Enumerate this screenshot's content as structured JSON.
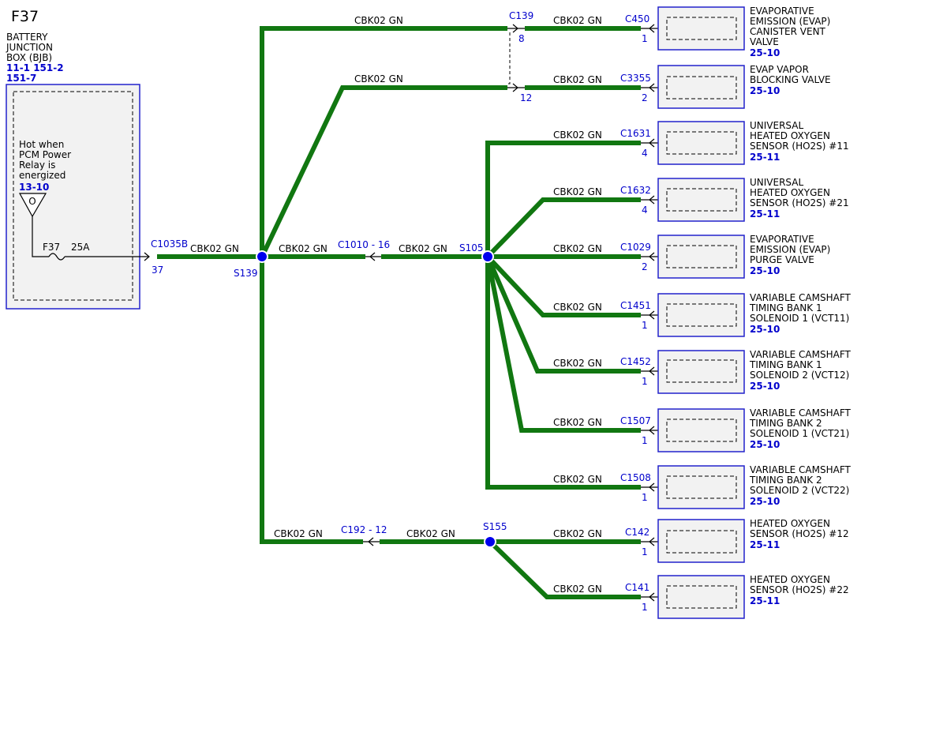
{
  "fuse_id": "F37",
  "bjb": {
    "lines": [
      "BATTERY",
      "JUNCTION",
      "BOX (BJB)"
    ],
    "refs1": "11-1  151-2",
    "refs2": "151-7",
    "hot_lines": [
      "Hot when",
      "PCM Power",
      "Relay is",
      "energized"
    ],
    "hot_ref": "13-10",
    "indicator": "O",
    "fuse_label": "F37",
    "fuse_rating": "25A"
  },
  "connectors": {
    "c1035b": "C1035B",
    "c1035b_pin": "37",
    "c1010": "C1010 - 16",
    "c192": "C192 - 12",
    "c139": "C139",
    "c139_pin_a": "8",
    "c139_pin_b": "12"
  },
  "splices": {
    "s139": "S139",
    "s105": "S105",
    "s155": "S155"
  },
  "wire_label": "CBK02  GN",
  "components": [
    {
      "connector": "C450",
      "pin": "1",
      "lines": [
        "EVAPORATIVE",
        "EMISSION (EVAP)",
        "CANISTER VENT",
        "VALVE"
      ],
      "ref": "25-10"
    },
    {
      "connector": "C3355",
      "pin": "2",
      "lines": [
        "EVAP VAPOR",
        "BLOCKING VALVE"
      ],
      "ref": "25-10"
    },
    {
      "connector": "C1631",
      "pin": "4",
      "lines": [
        "UNIVERSAL",
        "HEATED OXYGEN",
        "SENSOR (HO2S) #11"
      ],
      "ref": "25-11"
    },
    {
      "connector": "C1632",
      "pin": "4",
      "lines": [
        "UNIVERSAL",
        "HEATED OXYGEN",
        "SENSOR (HO2S) #21"
      ],
      "ref": "25-11"
    },
    {
      "connector": "C1029",
      "pin": "2",
      "lines": [
        "EVAPORATIVE",
        "EMISSION (EVAP)",
        "PURGE VALVE"
      ],
      "ref": "25-10"
    },
    {
      "connector": "C1451",
      "pin": "1",
      "lines": [
        "VARIABLE CAMSHAFT",
        "TIMING BANK 1",
        "SOLENOID 1 (VCT11)"
      ],
      "ref": "25-10"
    },
    {
      "connector": "C1452",
      "pin": "1",
      "lines": [
        "VARIABLE CAMSHAFT",
        "TIMING BANK 1",
        "SOLENOID 2 (VCT12)"
      ],
      "ref": "25-10"
    },
    {
      "connector": "C1507",
      "pin": "1",
      "lines": [
        "VARIABLE CAMSHAFT",
        "TIMING BANK 2",
        "SOLENOID 1 (VCT21)"
      ],
      "ref": "25-10"
    },
    {
      "connector": "C1508",
      "pin": "1",
      "lines": [
        "VARIABLE CAMSHAFT",
        "TIMING BANK 2",
        "SOLENOID 2 (VCT22)"
      ],
      "ref": "25-10"
    },
    {
      "connector": "C142",
      "pin": "1",
      "lines": [
        "HEATED OXYGEN",
        "SENSOR (HO2S) #12"
      ],
      "ref": "25-11"
    },
    {
      "connector": "C141",
      "pin": "1",
      "lines": [
        "HEATED OXYGEN",
        "SENSOR (HO2S) #22"
      ],
      "ref": "25-11"
    }
  ],
  "colors": {
    "wire": "#117711",
    "link": "#0000cc",
    "box_border": "#2222cc",
    "box_fill": "#f2f2f2"
  }
}
